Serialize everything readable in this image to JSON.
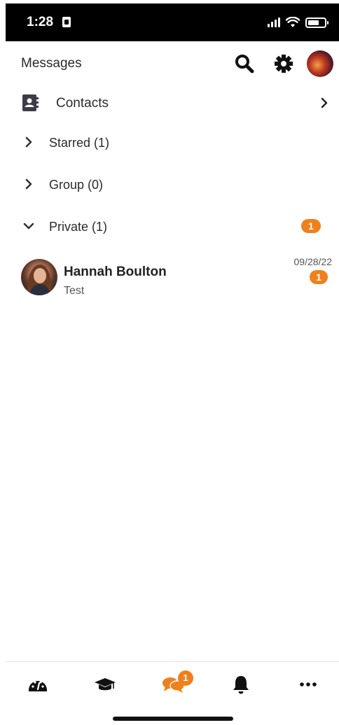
{
  "status_bar": {
    "time": "1:28"
  },
  "header": {
    "title": "Messages"
  },
  "contacts": {
    "label": "Contacts"
  },
  "sections": {
    "starred": "Starred (1)",
    "group": "Group (0)",
    "private": "Private (1)",
    "private_badge": "1"
  },
  "conversation": {
    "name": "Hannah Boulton",
    "preview": "Test",
    "date": "09/28/22",
    "unread": "1"
  },
  "tabbar": {
    "messages_badge": "1",
    "icons": [
      "dashboard-icon",
      "graduation-cap-icon",
      "chat-bubbles-icon",
      "bell-icon",
      "more-icon"
    ]
  },
  "colors": {
    "accent": "#f0801c",
    "text": "#222222",
    "status_bar": "#000000"
  }
}
